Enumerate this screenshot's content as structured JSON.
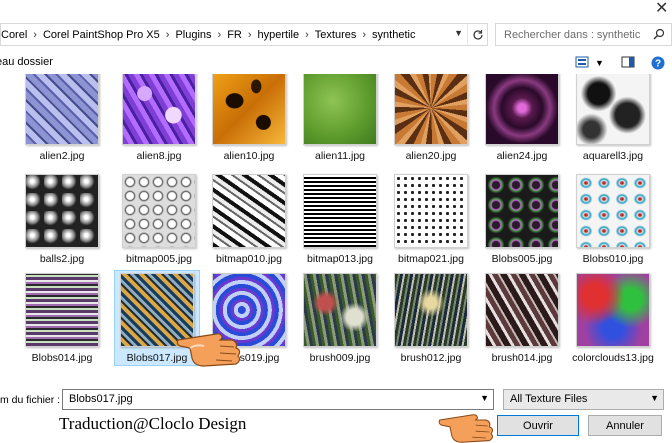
{
  "window": {
    "close_glyph": "✕"
  },
  "address": {
    "crumbs": [
      "Corel",
      "Corel PaintShop Pro X5",
      "Plugins",
      "FR",
      "hypertile",
      "Textures",
      "synthetic"
    ],
    "separator": "›"
  },
  "search": {
    "placeholder": "Rechercher dans : synthetic"
  },
  "toolbar": {
    "new_folder": "eau dossier"
  },
  "files": [
    {
      "name": "alien2.jpg"
    },
    {
      "name": "alien8.jpg"
    },
    {
      "name": "alien10.jpg"
    },
    {
      "name": "alien11.jpg"
    },
    {
      "name": "alien20.jpg"
    },
    {
      "name": "alien24.jpg"
    },
    {
      "name": "aquarell3.jpg"
    },
    {
      "name": "balls2.jpg"
    },
    {
      "name": "bitmap005.jpg"
    },
    {
      "name": "bitmap010.jpg"
    },
    {
      "name": "bitmap013.jpg"
    },
    {
      "name": "bitmap021.jpg"
    },
    {
      "name": "Blobs005.jpg"
    },
    {
      "name": "Blobs010.jpg"
    },
    {
      "name": "Blobs014.jpg"
    },
    {
      "name": "Blobs017.jpg"
    },
    {
      "name": "Blobs019.jpg"
    },
    {
      "name": "brush009.jpg"
    },
    {
      "name": "brush012.jpg"
    },
    {
      "name": "brush014.jpg"
    },
    {
      "name": "colorclouds13.jpg"
    }
  ],
  "selected_file": "Blobs017.jpg",
  "footer": {
    "filename_label": "m du fichier :",
    "filename_value": "Blobs017.jpg",
    "filter_value": "All Texture Files",
    "open_label": "Ouvrir",
    "cancel_label": "Annuler"
  },
  "watermark": "Traduction@Cloclo Design"
}
